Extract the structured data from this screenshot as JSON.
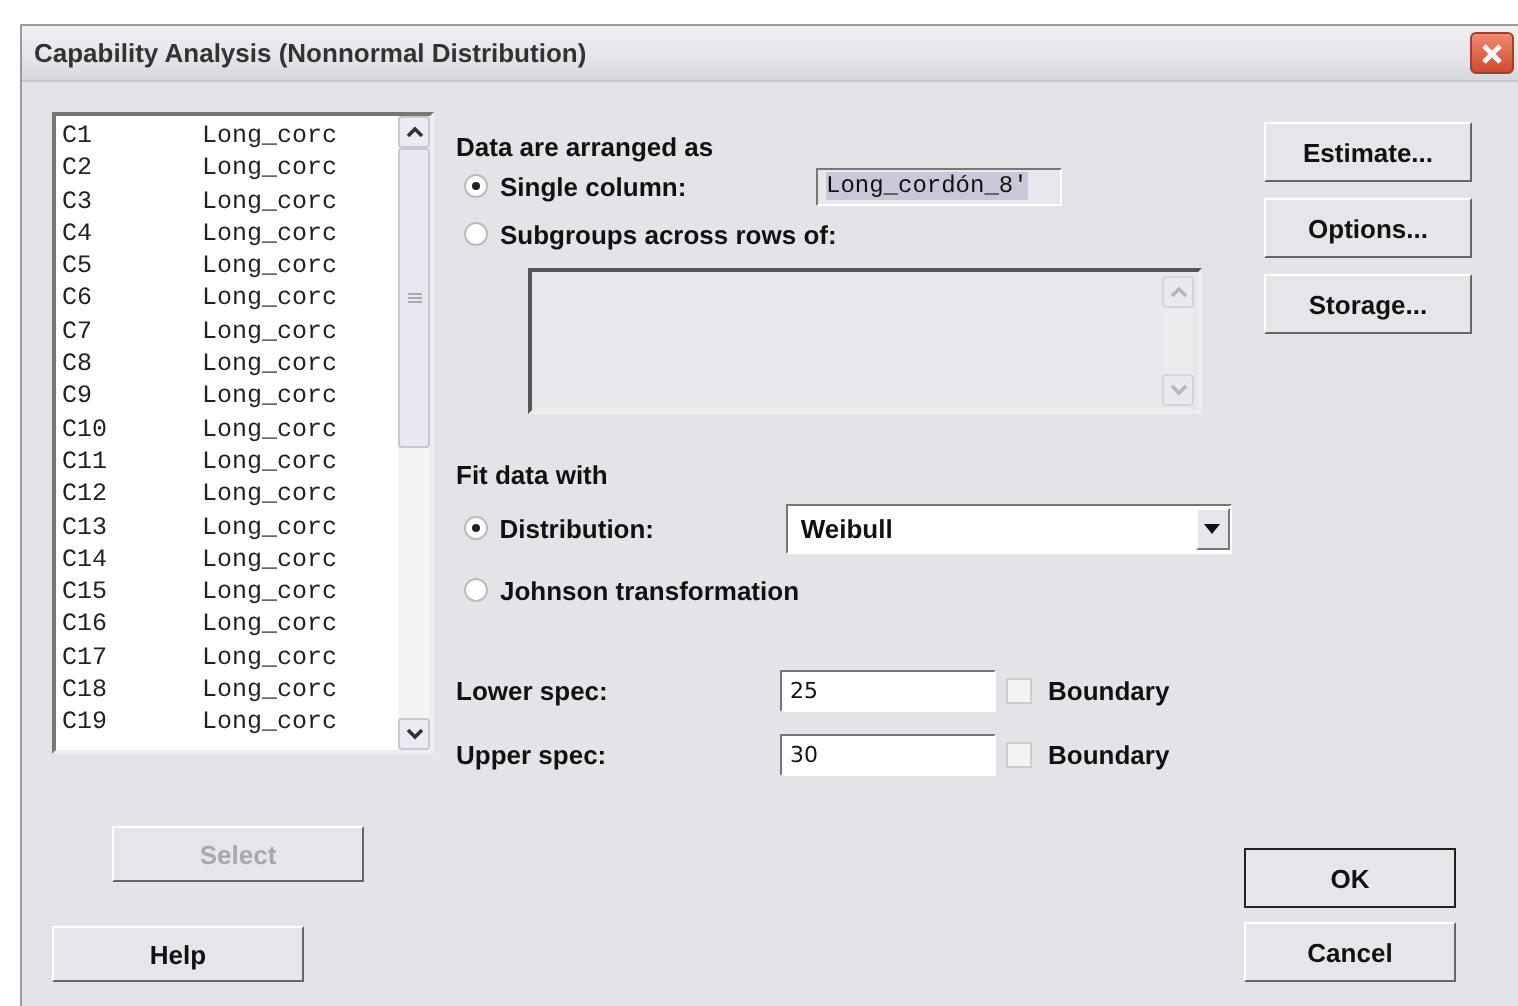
{
  "window": {
    "title": "Capability Analysis (Nonnormal Distribution)"
  },
  "columns": [
    {
      "id": "C1",
      "name": "Long_corc"
    },
    {
      "id": "C2",
      "name": "Long_corc"
    },
    {
      "id": "C3",
      "name": "Long_corc"
    },
    {
      "id": "C4",
      "name": "Long_corc"
    },
    {
      "id": "C5",
      "name": "Long_corc"
    },
    {
      "id": "C6",
      "name": "Long_corc"
    },
    {
      "id": "C7",
      "name": "Long_corc"
    },
    {
      "id": "C8",
      "name": "Long_corc"
    },
    {
      "id": "C9",
      "name": "Long_corc"
    },
    {
      "id": "C10",
      "name": "Long_corc"
    },
    {
      "id": "C11",
      "name": "Long_corc"
    },
    {
      "id": "C12",
      "name": "Long_corc"
    },
    {
      "id": "C13",
      "name": "Long_corc"
    },
    {
      "id": "C14",
      "name": "Long_corc"
    },
    {
      "id": "C15",
      "name": "Long_corc"
    },
    {
      "id": "C16",
      "name": "Long_corc"
    },
    {
      "id": "C17",
      "name": "Long_corc"
    },
    {
      "id": "C18",
      "name": "Long_corc"
    },
    {
      "id": "C19",
      "name": "Long_corc"
    }
  ],
  "select_button": {
    "label": "Select",
    "disabled": true
  },
  "help_button": {
    "label": "Help"
  },
  "arrangement": {
    "heading": "Data are arranged as",
    "single": {
      "label": "Single column:",
      "selected": true,
      "value": "Long_cordón_8'"
    },
    "subgroups": {
      "label": "Subgroups across rows of:",
      "selected": false
    }
  },
  "fit": {
    "heading": "Fit data with",
    "distribution": {
      "label": "Distribution:",
      "selected": true,
      "value": "Weibull"
    },
    "johnson": {
      "label": "Johnson transformation",
      "selected": false
    }
  },
  "specs": [
    {
      "label": "Lower spec:",
      "value": "25",
      "boundary_label": "Boundary",
      "checked": false
    },
    {
      "label": "Upper spec:",
      "value": "30",
      "boundary_label": "Boundary",
      "checked": false
    }
  ],
  "side_buttons": [
    "Estimate...",
    "Options...",
    "Storage..."
  ],
  "ok_button": "OK",
  "cancel_button": "Cancel"
}
